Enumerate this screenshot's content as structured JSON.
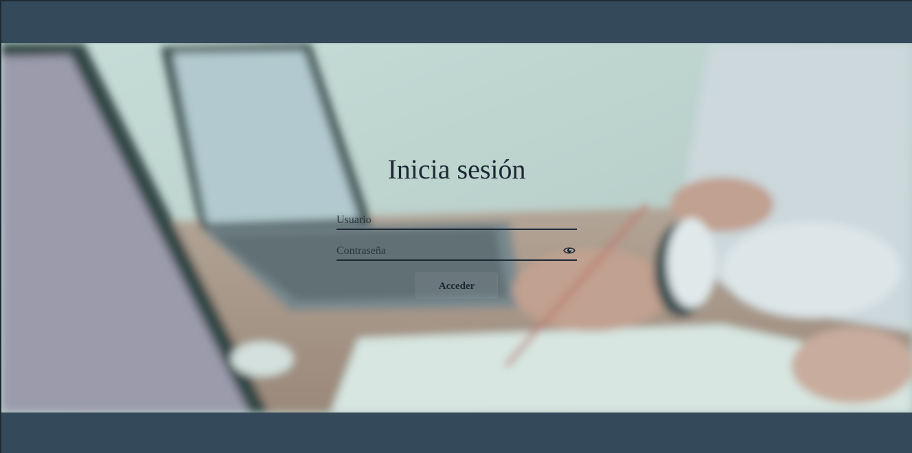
{
  "login": {
    "title": "Inicia sesión",
    "username_placeholder": "Usuario",
    "username_value": "",
    "password_placeholder": "Contraseña",
    "password_value": "",
    "submit_label": "Acceder",
    "password_toggle_icon": "eye-icon"
  },
  "theme": {
    "header_color": "#34495a",
    "text_color": "#1c2833"
  }
}
